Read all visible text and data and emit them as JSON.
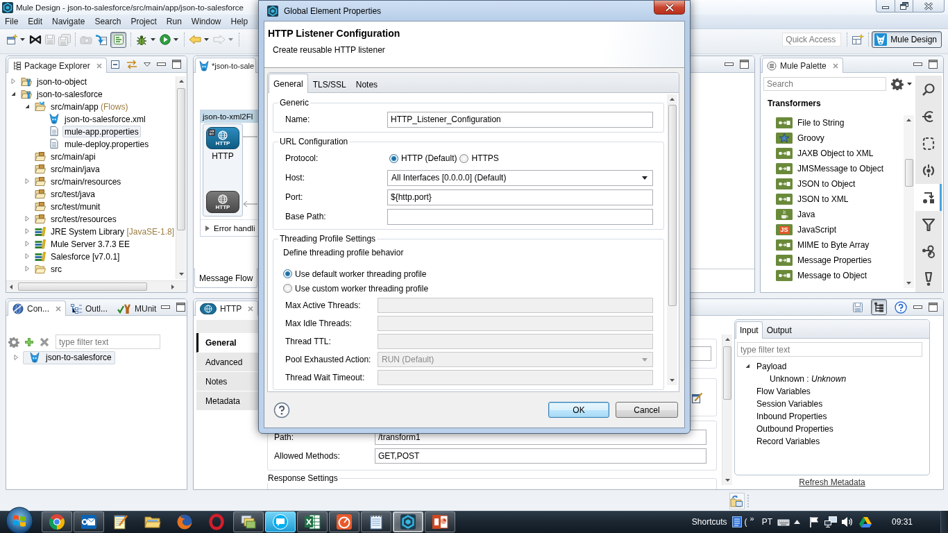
{
  "window": {
    "title": "Mule Design - json-to-salesforce/src/main/app/json-to-salesforce"
  },
  "menu": [
    "File",
    "Edit",
    "Navigate",
    "Search",
    "Project",
    "Run",
    "Window",
    "Help"
  ],
  "toolbar": {
    "buttons": [
      {
        "kind": "new",
        "disabled": false,
        "pressed": false,
        "dropdown": true
      },
      {
        "kind": "bowtie",
        "disabled": false,
        "pressed": false,
        "dropdown": false
      },
      {
        "kind": "save",
        "disabled": true,
        "pressed": false,
        "dropdown": false
      },
      {
        "kind": "save_all",
        "disabled": true,
        "pressed": false,
        "dropdown": false
      },
      {
        "kind": "camera",
        "disabled": true,
        "pressed": false,
        "dropdown": false
      },
      {
        "kind": "deploy",
        "disabled": false,
        "pressed": false,
        "dropdown": false
      },
      {
        "kind": "lines",
        "disabled": false,
        "pressed": true,
        "dropdown": false
      },
      {
        "kind": "bug",
        "disabled": false,
        "pressed": false,
        "dropdown": true
      },
      {
        "kind": "run",
        "disabled": false,
        "pressed": false,
        "dropdown": true
      },
      {
        "kind": "back",
        "disabled": false,
        "pressed": false,
        "dropdown": true
      },
      {
        "kind": "forward",
        "disabled": true,
        "pressed": false,
        "dropdown": true
      }
    ],
    "quick_access": {
      "placeholder": "Quick Access"
    },
    "perspectives": [
      {
        "label": "Mule Design",
        "selected": true
      }
    ]
  },
  "package_explorer": {
    "title": "Package Explorer",
    "tree": [
      {
        "label": "json-to-object",
        "kind": "project",
        "expanded": false,
        "selected": false
      },
      {
        "label": "json-to-salesforce",
        "kind": "project",
        "expanded": true,
        "selected": false,
        "children": [
          {
            "label": "src/main/app",
            "decoration": "(Flows)",
            "kind": "app",
            "expanded": true,
            "selected": false,
            "children": [
              {
                "label": "json-to-salesforce.xml",
                "kind": "mule",
                "selected": false
              },
              {
                "label": "mule-app.properties",
                "kind": "file",
                "selected": true
              },
              {
                "label": "mule-deploy.properties",
                "kind": "file",
                "selected": false
              }
            ]
          },
          {
            "label": "src/main/api",
            "kind": "source",
            "selected": false
          },
          {
            "label": "src/main/java",
            "kind": "source",
            "selected": false
          },
          {
            "label": "src/main/resources",
            "kind": "source",
            "expanded": false,
            "selected": false
          },
          {
            "label": "src/test/java",
            "kind": "source",
            "selected": false
          },
          {
            "label": "src/test/munit",
            "kind": "source",
            "selected": false
          },
          {
            "label": "src/test/resources",
            "kind": "source",
            "expanded": false,
            "selected": false
          },
          {
            "label": "JRE System Library",
            "decoration": "[JavaSE-1.8]",
            "kind": "library",
            "expanded": false,
            "selected": false
          },
          {
            "label": "Mule Server 3.7.3 EE",
            "kind": "library",
            "expanded": false,
            "selected": false
          },
          {
            "label": "Salesforce [v7.0.1]",
            "kind": "library",
            "expanded": false,
            "selected": false
          },
          {
            "label": "src",
            "kind": "folder",
            "expanded": false,
            "selected": false
          }
        ]
      }
    ]
  },
  "editor": {
    "tab": "*json-to-sale",
    "flow": {
      "name": "json-to-xml2Fl",
      "nodes": [
        {
          "kind": "source",
          "badge": "HTTP",
          "label": "HTTP"
        },
        {
          "kind": "response",
          "badge": "HTTP"
        }
      ],
      "error_handling": {
        "label": "Error handli",
        "expanded": false
      }
    },
    "bottom_tabs": [
      {
        "label": "Message Flow",
        "selected": true
      }
    ]
  },
  "palette": {
    "title": "Mule Palette",
    "search": {
      "placeholder": "Search"
    },
    "category": "Transformers",
    "items": [
      {
        "label": "File to String",
        "kind": "transformer"
      },
      {
        "label": "Groovy",
        "kind": "star"
      },
      {
        "label": "JAXB Object to XML",
        "kind": "transformer"
      },
      {
        "label": "JMSMessage to Object",
        "kind": "transformer"
      },
      {
        "label": "JSON to Object",
        "kind": "transformer"
      },
      {
        "label": "JSON to XML",
        "kind": "transformer"
      },
      {
        "label": "Java",
        "kind": "java"
      },
      {
        "label": "JavaScript",
        "kind": "script",
        "badge": "JS"
      },
      {
        "label": "MIME to Byte Array",
        "kind": "transformer"
      },
      {
        "label": "Message Properties",
        "kind": "transformer"
      },
      {
        "label": "Message to Object",
        "kind": "transformer"
      }
    ],
    "side_tools": [
      {
        "kind": "search",
        "selected": false
      },
      {
        "kind": "endpoint",
        "selected": false
      },
      {
        "kind": "scope",
        "selected": false
      },
      {
        "kind": "component",
        "selected": false
      },
      {
        "kind": "transformer",
        "selected": true
      },
      {
        "kind": "filter",
        "selected": false
      },
      {
        "kind": "flow",
        "selected": false
      },
      {
        "kind": "exception",
        "selected": false
      }
    ]
  },
  "connections": {
    "tabs": [
      {
        "label": "Con...",
        "selected": true
      },
      {
        "label": "Outl...",
        "selected": false
      },
      {
        "label": "MUnit",
        "selected": false
      }
    ],
    "filter": {
      "placeholder": "type filter text"
    },
    "tree": [
      {
        "label": "json-to-salesforce",
        "kind": "mule",
        "expanded": false,
        "selected": true
      }
    ]
  },
  "properties": {
    "tab": "HTTP",
    "tools": [
      {
        "kind": "save",
        "pressed": false
      },
      {
        "kind": "tree",
        "pressed": true
      },
      {
        "kind": "help",
        "pressed": false
      }
    ],
    "side_tabs": [
      {
        "label": "General",
        "selected": true
      },
      {
        "label": "Advanced",
        "selected": false
      },
      {
        "label": "Notes",
        "selected": false
      },
      {
        "label": "Metadata",
        "selected": false
      }
    ],
    "fields": [
      {
        "label": "Path:",
        "value": "/transform1"
      },
      {
        "label": "Allowed Methods:",
        "value": "GET,POST"
      }
    ],
    "group": "Response Settings",
    "metadata": {
      "tabs": [
        {
          "label": "Input",
          "selected": true
        },
        {
          "label": "Output",
          "selected": false
        }
      ],
      "filter": {
        "placeholder": "type filter text"
      },
      "tree": [
        {
          "label": "Payload",
          "expanded": true,
          "children": [
            {
              "label": "Unknown : *Unknown*"
            }
          ]
        },
        {
          "label": "Flow Variables"
        },
        {
          "label": "Session Variables"
        },
        {
          "label": "Inbound Properties"
        },
        {
          "label": "Outbound Properties"
        },
        {
          "label": "Record Variables"
        }
      ],
      "link": "Refresh Metadata"
    }
  },
  "dialog": {
    "title": "Global Element Properties",
    "heading": "HTTP Listener Configuration",
    "description": "Create reusable HTTP listener",
    "tabs": [
      {
        "label": "General",
        "selected": true
      },
      {
        "label": "TLS/SSL",
        "selected": false
      },
      {
        "label": "Notes",
        "selected": false
      }
    ],
    "groups": [
      {
        "title": "Generic",
        "rows": [
          {
            "kind": "text",
            "label": "Name:",
            "value": "HTTP_Listener_Configuration",
            "disabled": false
          }
        ]
      },
      {
        "title": "URL Configuration",
        "rows": [
          {
            "kind": "radio",
            "label": "Protocol:",
            "options": [
              {
                "label": "HTTP (Default)",
                "selected": true
              },
              {
                "label": "HTTPS",
                "selected": false
              }
            ]
          },
          {
            "kind": "select",
            "label": "Host:",
            "value": "All Interfaces [0.0.0.0] (Default)",
            "disabled": false
          },
          {
            "kind": "text",
            "label": "Port:",
            "value": "${http.port}",
            "disabled": false
          },
          {
            "kind": "text",
            "label": "Base Path:",
            "disabled": false
          }
        ]
      },
      {
        "title": "Threading Profile Settings",
        "description": "Define threading profile behavior",
        "options": [
          {
            "label": "Use default worker threading profile",
            "selected": true
          },
          {
            "label": "Use custom worker threading profile",
            "selected": false
          }
        ],
        "rows": [
          {
            "kind": "text",
            "label": "Max Active Threads:",
            "disabled": true
          },
          {
            "kind": "text",
            "label": "Max Idle Threads:",
            "disabled": true
          },
          {
            "kind": "text",
            "label": "Thread TTL:",
            "disabled": true
          },
          {
            "kind": "select",
            "label": "Pool Exhausted Action:",
            "value": "RUN (Default)",
            "disabled": true
          },
          {
            "kind": "text",
            "label": "Thread Wait Timeout:",
            "disabled": true
          }
        ]
      }
    ],
    "buttons": [
      {
        "label": "OK",
        "default": true
      },
      {
        "label": "Cancel",
        "default": false
      }
    ]
  },
  "taskbar": {
    "apps": [
      {
        "kind": "wheel",
        "running": true,
        "selected": false,
        "attention": false
      },
      {
        "kind": "mail",
        "running": true,
        "selected": false,
        "attention": false
      },
      {
        "kind": "notepad",
        "running": false,
        "selected": false,
        "attention": false
      },
      {
        "kind": "folder",
        "running": false,
        "selected": false,
        "attention": false
      },
      {
        "kind": "fox",
        "running": false,
        "selected": false,
        "attention": false
      },
      {
        "kind": "ring",
        "running": false,
        "selected": false,
        "attention": false
      },
      {
        "kind": "windows",
        "running": true,
        "selected": false,
        "attention": false
      },
      {
        "kind": "chat",
        "running": true,
        "selected": false,
        "attention": true
      },
      {
        "kind": "sheet",
        "running": true,
        "selected": false,
        "attention": false
      },
      {
        "kind": "gauge",
        "running": true,
        "selected": false,
        "attention": false
      },
      {
        "kind": "notes",
        "running": true,
        "selected": false,
        "attention": false
      },
      {
        "kind": "hexagon",
        "running": true,
        "selected": true,
        "attention": false
      },
      {
        "kind": "slides",
        "running": true,
        "selected": false,
        "attention": false
      }
    ],
    "tray": {
      "toolbar": "Shortcuts",
      "item": "(",
      "overflow": "»",
      "language": "PT"
    },
    "clock": "09:31"
  }
}
